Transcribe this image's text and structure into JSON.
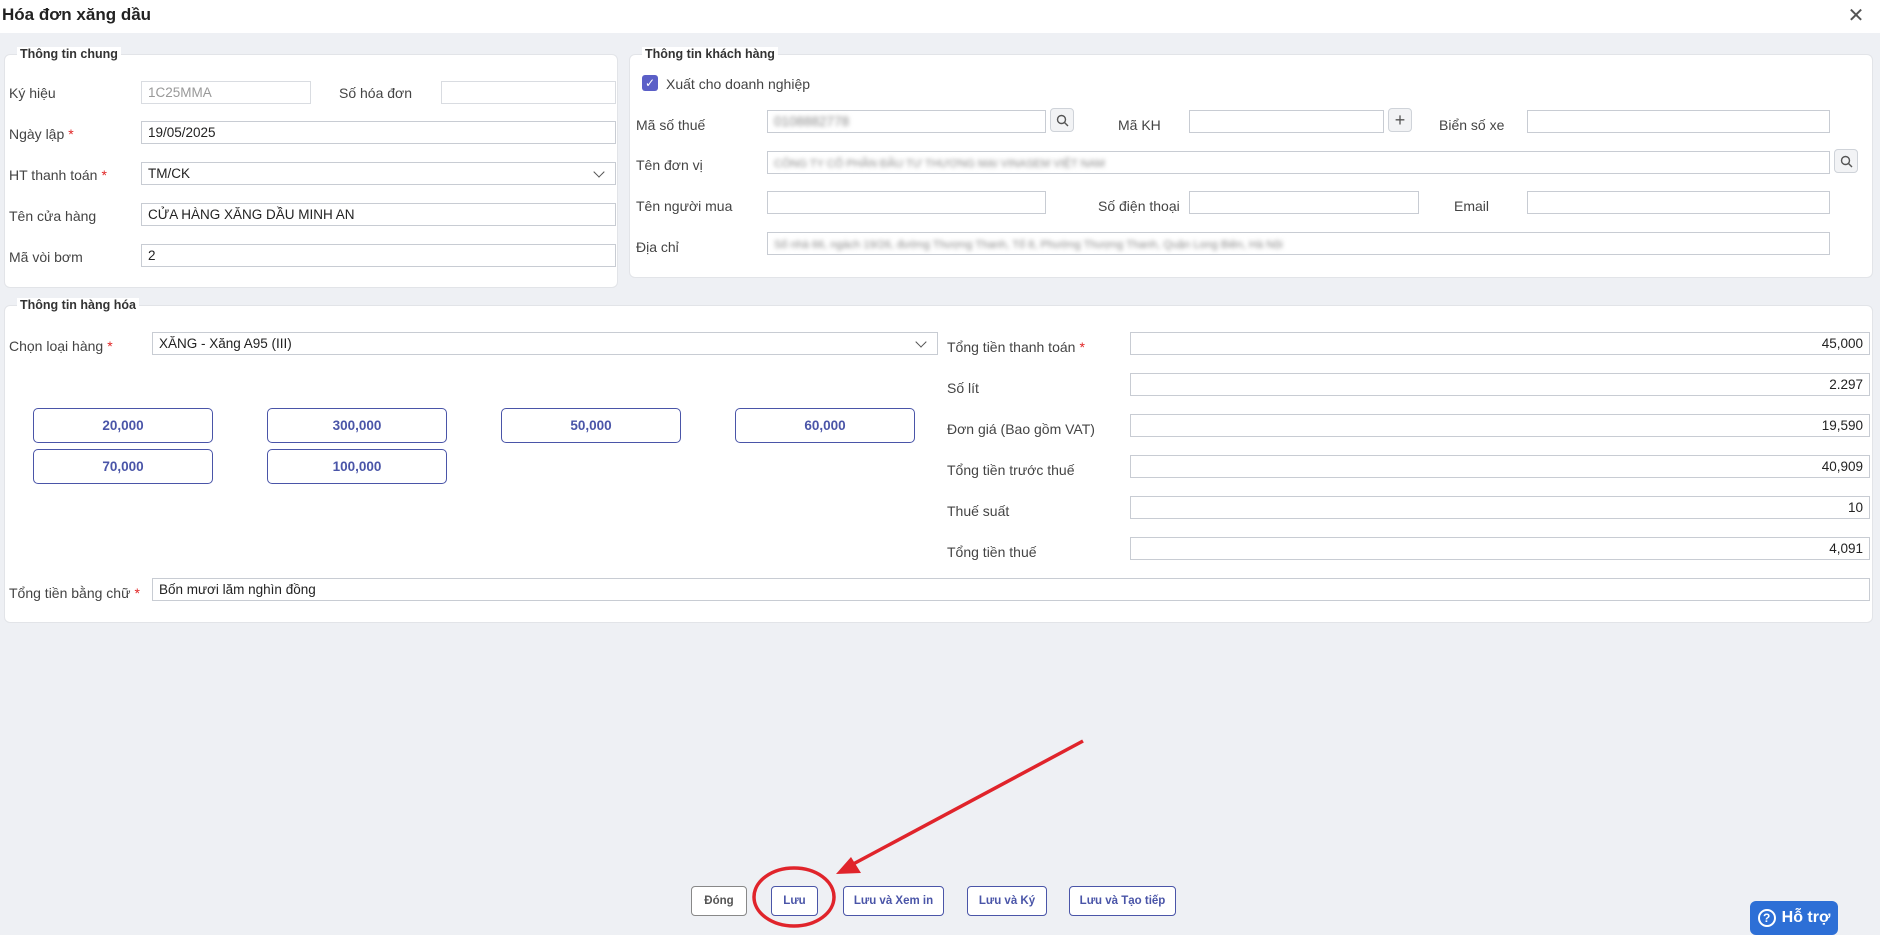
{
  "dialog": {
    "title": "Hóa đơn xăng dầu"
  },
  "general": {
    "title": "Thông tin chung",
    "ky_hieu_label": "Ký hiệu",
    "ky_hieu_value": "1C25MMA",
    "so_hd_label": "Số hóa đơn",
    "so_hd_value": "",
    "ngay_lap_label": "Ngày lập",
    "ngay_lap_value": "19/05/2025",
    "ht_tt_label": "HT thanh toán",
    "ht_tt_value": "TM/CK",
    "ten_cua_hang_label": "Tên cửa hàng",
    "ten_cua_hang_value": "CỬA HÀNG XĂNG DẦU MINH AN",
    "ma_voi_bom_label": "Mã vòi bơm",
    "ma_voi_bom_value": "2",
    "required_mark": "*"
  },
  "customer": {
    "title": "Thông tin khách hàng",
    "xuat_dn_label": "Xuất cho doanh nghiệp",
    "xuat_dn_checked": true,
    "mst_label": "Mã số thuế",
    "mst_value": "0108882778",
    "ma_kh_label": "Mã KH",
    "ma_kh_value": "",
    "bien_so_label": "Biển số xe",
    "bien_so_value": "",
    "ten_dv_label": "Tên đơn vị",
    "ten_dv_value": "CÔNG TY CỔ PHẦN ĐẦU TƯ THƯƠNG MẠI VINASEM VIỆT NAM",
    "ten_nm_label": "Tên người mua",
    "ten_nm_value": "",
    "sdt_label": "Số điện thoại",
    "sdt_value": "",
    "email_label": "Email",
    "email_value": "",
    "dia_chi_label": "Địa chỉ",
    "dia_chi_value": "Số nhà 66, ngách 19/26, đường Thượng Thanh, Tổ 8, Phường Thượng Thanh, Quận Long Biên, Hà Nội"
  },
  "goods": {
    "title": "Thông tin hàng hóa",
    "chon_loai_label": "Chọn loại hàng",
    "chon_loai_value": "XĂNG - Xăng A95 (III)",
    "amounts": [
      "20,000",
      "300,000",
      "50,000",
      "60,000",
      "70,000",
      "100,000"
    ],
    "tong_tt_label": "Tổng tiền thanh toán",
    "tong_tt_value": "45,000",
    "so_lit_label": "Số lít",
    "so_lit_value": "2.297",
    "don_gia_label": "Đơn giá (Bao gồm VAT)",
    "don_gia_value": "19,590",
    "truoc_thue_label": "Tổng tiền trước thuế",
    "truoc_thue_value": "40,909",
    "thue_suat_label": "Thuế suất",
    "thue_suat_value": "10",
    "tien_thue_label": "Tổng tiền thuế",
    "tien_thue_value": "4,091",
    "bang_chu_label": "Tổng tiền bằng chữ",
    "bang_chu_value": "Bốn mươi lăm nghìn đồng"
  },
  "footer": {
    "dong": "Đóng",
    "luu": "Lưu",
    "luu_xem_in": "Lưu và Xem in",
    "luu_ky": "Lưu và Ký",
    "luu_tao_tiep": "Lưu và Tạo tiếp"
  },
  "help": {
    "label": "Hỗ trợ"
  },
  "colors": {
    "accent": "#4a55a8",
    "required": "#e02424",
    "annotation": "#e0242b",
    "help": "#2d6fd6"
  }
}
